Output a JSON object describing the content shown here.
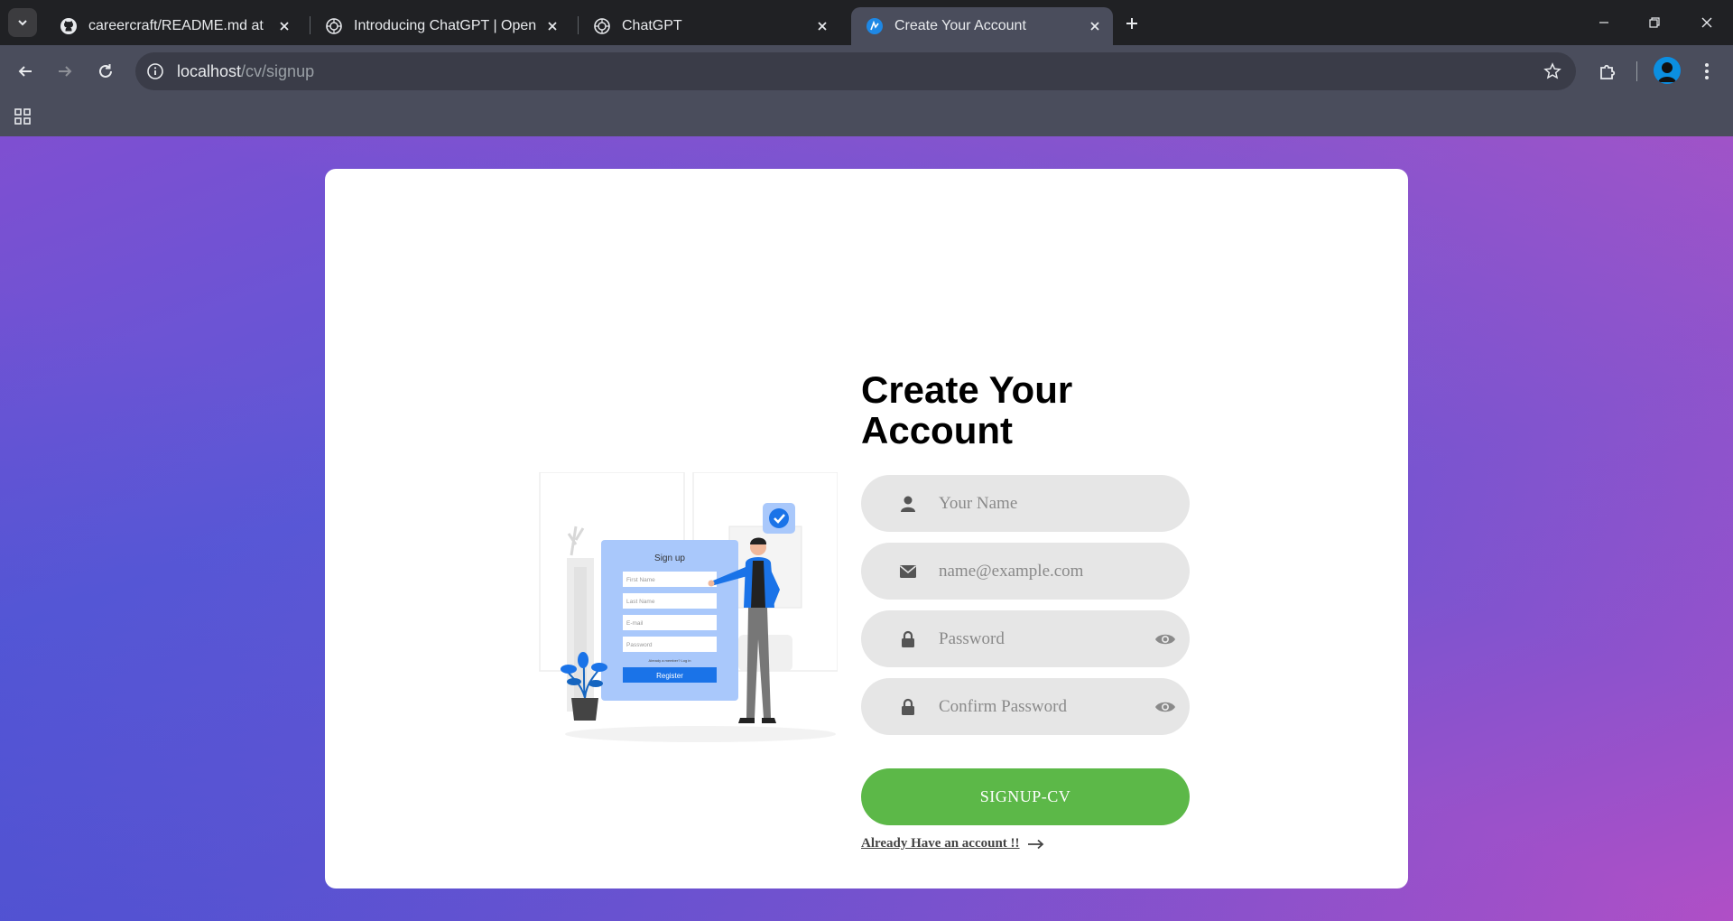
{
  "browser": {
    "tabs": [
      {
        "title": "careercraft/README.md at main",
        "icon": "github-icon",
        "active": false
      },
      {
        "title": "Introducing ChatGPT | OpenAI",
        "icon": "openai-icon",
        "active": false
      },
      {
        "title": "ChatGPT",
        "icon": "openai-icon",
        "active": false
      },
      {
        "title": "Create Your Account",
        "icon": "app-favicon-icon",
        "active": true
      }
    ],
    "url_host": "localhost",
    "url_path": "/cv/signup"
  },
  "signup": {
    "title": "Create Your Account",
    "name_placeholder": "Your Name",
    "email_placeholder": "name@example.com",
    "password_placeholder": "Password",
    "confirm_placeholder": "Confirm Password",
    "submit_label": "SIGNUP-CV",
    "login_link": "Already Have an account !!"
  },
  "illustration": {
    "heading": "Sign up",
    "fields": [
      "First Name",
      "Last Name",
      "E-mail",
      "Password"
    ],
    "footer_text": "Already a member? Log in",
    "button": "Register"
  },
  "colors": {
    "accent_green": "#5cb848",
    "gradient_start": "#5c58d6",
    "gradient_end": "#c24fc4",
    "illustration_blue": "#1a73e8"
  }
}
